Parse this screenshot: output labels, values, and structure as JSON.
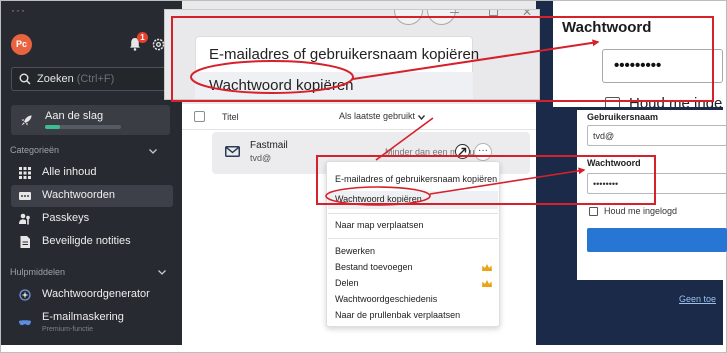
{
  "colors": {
    "annotation_red": "#d6202a",
    "sidebar_bg": "#272a30",
    "accent_green": "#3dbd8f",
    "brand_dark_blue": "#1b2a49",
    "button_blue": "#2876d4",
    "premium_crown": "#e9a316"
  },
  "sidebar": {
    "menu_dots": "···",
    "avatar_initials": "Pc",
    "notification_count": "1",
    "search": {
      "label": "Zoeken",
      "shortcut": "(Ctrl+F)"
    },
    "getting_started": {
      "label": "Aan de slag",
      "progress": 0.2
    },
    "categories_header": "Categorieën",
    "categories": [
      {
        "label": "Alle inhoud",
        "icon": "grid-icon"
      },
      {
        "label": "Wachtwoorden",
        "icon": "password-icon",
        "active": true
      },
      {
        "label": "Passkeys",
        "icon": "passkey-icon"
      },
      {
        "label": "Beveiligde notities",
        "icon": "note-icon"
      }
    ],
    "tools_header": "Hulpmiddelen",
    "tools": [
      {
        "label": "Wachtwoordgenerator",
        "icon": "generator-icon"
      },
      {
        "label": "E-mailmaskering",
        "sublabel": "Premium-functie",
        "icon": "mask-icon"
      }
    ]
  },
  "list": {
    "column_title": "Titel",
    "sort_label": "Als laatste gebruikt",
    "item": {
      "name": "Fastmail",
      "username": "tvd@",
      "last_used": "Minder dan een minuut gel",
      "icon": "mail-icon",
      "more_label": "···"
    }
  },
  "context_menu": {
    "groups": [
      [
        "E-mailadres of gebruikersnaam kopiëren",
        "Wachtwoord kopiëren"
      ],
      [
        "Naar map verplaatsen"
      ],
      [
        "Bewerken",
        "Bestand toevoegen",
        "Delen",
        "Wachtwoordgeschiedenis",
        "Naar de prullenbak verplaatsen"
      ]
    ],
    "highlighted": "Wachtwoord kopiëren",
    "premium_items": [
      "Bestand toevoegen",
      "Delen"
    ]
  },
  "login_form": {
    "username_label": "Gebruikersnaam",
    "username_value": "tvd@",
    "password_label": "Wachtwoord",
    "password_value": "••••••••",
    "remember_label": "Houd me ingelogd",
    "footer_link": "Geen toe"
  },
  "zoom_menu": {
    "item1": "E-mailadres of gebruikersnaam kopiëren",
    "item2": "Wachtwoord kopiëren"
  },
  "zoom_form": {
    "password_label": "Wachtwoord",
    "password_value": "•••••••••",
    "remember_label": "Houd me ingelogd"
  }
}
